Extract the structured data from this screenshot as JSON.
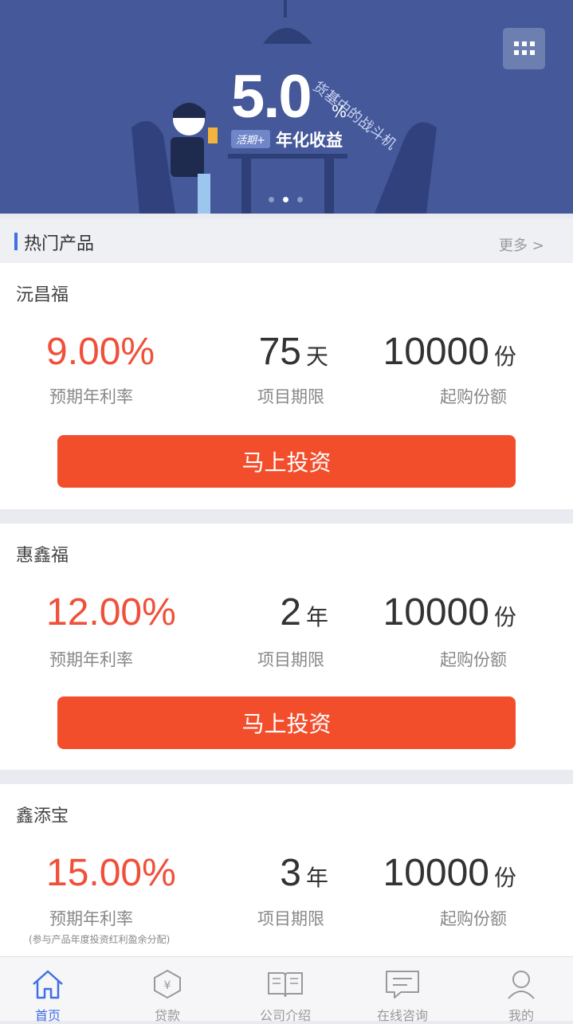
{
  "banner": {
    "rate": "5.0",
    "percent": "%",
    "badge": "活期+",
    "subtitle": "年化收益",
    "slogan": "货基中的战斗机",
    "grid_icon": "grid-icon",
    "active_slide": 2,
    "slide_count": 3
  },
  "section": {
    "title": "热门产品",
    "more": "更多 >"
  },
  "products": [
    {
      "name": "沅昌福",
      "rate": "9.00%",
      "rate_label": "预期年利率",
      "term_value": "75",
      "term_unit": "天",
      "term_label": "项目期限",
      "min_value": "10000",
      "min_unit": "份",
      "min_label": "起购份额",
      "button": "马上投资"
    },
    {
      "name": "惠鑫福",
      "rate": "12.00%",
      "rate_label": "预期年利率",
      "term_value": "2",
      "term_unit": "年",
      "term_label": "项目期限",
      "min_value": "10000",
      "min_unit": "份",
      "min_label": "起购份额",
      "button": "马上投资"
    },
    {
      "name": "鑫添宝",
      "rate": "15.00%",
      "rate_label": "预期年利率",
      "term_value": "3",
      "term_unit": "年",
      "term_label": "项目期限",
      "min_value": "10000",
      "min_unit": "份",
      "min_label": "起购份额",
      "note": "(参与产品年度投资红利盈余分配)"
    }
  ],
  "tabs": [
    {
      "label": "首页",
      "icon": "home-icon",
      "active": true
    },
    {
      "label": "贷款",
      "icon": "yuan-icon",
      "active": false
    },
    {
      "label": "公司介绍",
      "icon": "book-icon",
      "active": false
    },
    {
      "label": "在线咨询",
      "icon": "chat-icon",
      "active": false
    },
    {
      "label": "我的",
      "icon": "user-icon",
      "active": false
    }
  ],
  "colors": {
    "banner_bg": "#44589a",
    "accent": "#3f6fe5",
    "rate_red": "#f0503a",
    "button_red": "#f24e2c"
  }
}
